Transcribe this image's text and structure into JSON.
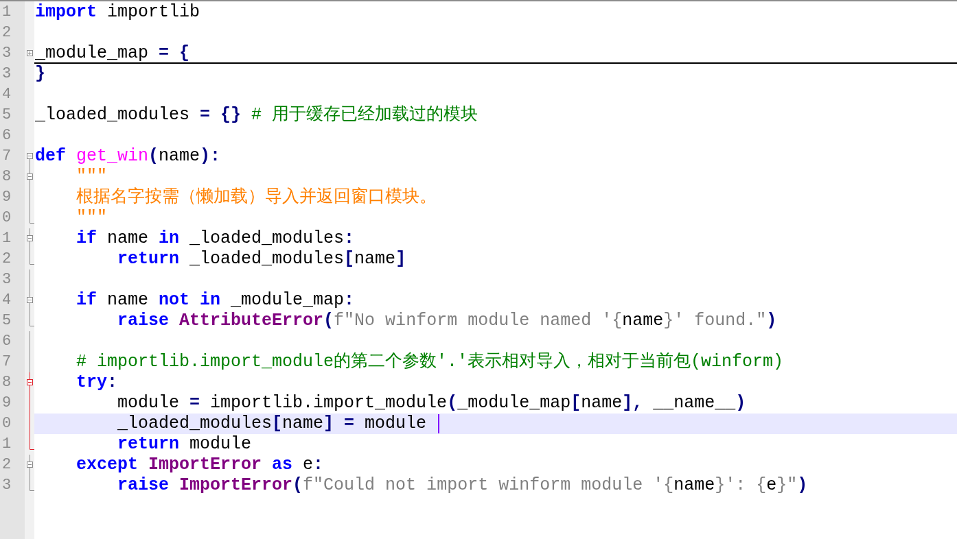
{
  "lines": [
    {
      "number": "1",
      "current": false,
      "tokens": [
        {
          "kind": "kw",
          "t": "import"
        },
        {
          "kind": "plain",
          "t": " importlib"
        }
      ]
    },
    {
      "number": "2",
      "current": false
    },
    {
      "number": "3",
      "fold": {
        "kind": "collapsed",
        "active": false
      },
      "current": false,
      "tokens": [
        {
          "kind": "plain",
          "t": "_module_map "
        },
        {
          "kind": "op",
          "t": "= {"
        }
      ]
    },
    {
      "number": "3",
      "current": false,
      "tokens": [
        {
          "kind": "op",
          "t": "}"
        }
      ]
    },
    {
      "number": "4",
      "current": false
    },
    {
      "number": "5",
      "current": false,
      "tokens": [
        {
          "kind": "plain",
          "t": "_loaded_modules "
        },
        {
          "kind": "op",
          "t": "= {}"
        },
        {
          "kind": "comment",
          "t": " # 用于缓存已经加载过的模块"
        }
      ]
    },
    {
      "number": "6",
      "current": false
    },
    {
      "number": "7",
      "fold": {
        "kind": "open-top",
        "active": false
      },
      "current": false,
      "tokens": [
        {
          "kind": "kw",
          "t": "def"
        },
        {
          "kind": "func",
          "t": " get_win"
        },
        {
          "kind": "op",
          "t": "("
        },
        {
          "kind": "plain",
          "t": "name"
        },
        {
          "kind": "op",
          "t": "):"
        }
      ]
    },
    {
      "number": "8",
      "fold": {
        "kind": "open",
        "active": false
      },
      "current": false,
      "tokens": [
        {
          "kind": "doc",
          "t": "    \"\"\""
        }
      ]
    },
    {
      "number": "9",
      "fold": {
        "kind": "body",
        "active": false
      },
      "current": false,
      "tokens": [
        {
          "kind": "doc",
          "t": "    根据名字按需（懒加载）导入并返回窗口模块。"
        }
      ]
    },
    {
      "number": "0",
      "fold": {
        "kind": "end",
        "active": false
      },
      "current": false,
      "tokens": [
        {
          "kind": "doc",
          "t": "    \"\"\""
        }
      ]
    },
    {
      "number": "1",
      "fold": {
        "kind": "open",
        "active": false
      },
      "current": false,
      "tokens": [
        {
          "kind": "kw",
          "t": "    if"
        },
        {
          "kind": "plain",
          "t": " name "
        },
        {
          "kind": "kw",
          "t": "in"
        },
        {
          "kind": "plain",
          "t": " _loaded_modules"
        },
        {
          "kind": "op",
          "t": ":"
        }
      ]
    },
    {
      "number": "2",
      "fold": {
        "kind": "end",
        "active": false
      },
      "current": false,
      "tokens": [
        {
          "kind": "kw",
          "t": "        return"
        },
        {
          "kind": "plain",
          "t": " _loaded_modules"
        },
        {
          "kind": "op",
          "t": "["
        },
        {
          "kind": "plain",
          "t": "name"
        },
        {
          "kind": "op",
          "t": "]"
        }
      ]
    },
    {
      "number": "3",
      "fold": {
        "kind": "body",
        "active": false
      },
      "current": false
    },
    {
      "number": "4",
      "fold": {
        "kind": "open",
        "active": false
      },
      "current": false,
      "tokens": [
        {
          "kind": "kw",
          "t": "    if"
        },
        {
          "kind": "plain",
          "t": " name "
        },
        {
          "kind": "kw",
          "t": "not in"
        },
        {
          "kind": "plain",
          "t": " _module_map"
        },
        {
          "kind": "op",
          "t": ":"
        }
      ]
    },
    {
      "number": "5",
      "fold": {
        "kind": "end",
        "active": false
      },
      "current": false,
      "tokens": [
        {
          "kind": "kw",
          "t": "        raise"
        },
        {
          "kind": "cls",
          "t": " AttributeError"
        },
        {
          "kind": "op",
          "t": "("
        },
        {
          "kind": "fstr",
          "t": "f\"No winform module named '{"
        },
        {
          "kind": "plain",
          "t": "name"
        },
        {
          "kind": "fstr",
          "t": "}' found.\""
        },
        {
          "kind": "op",
          "t": ")"
        }
      ]
    },
    {
      "number": "6",
      "fold": {
        "kind": "body",
        "active": false
      },
      "current": false
    },
    {
      "number": "7",
      "fold": {
        "kind": "body",
        "active": false
      },
      "current": false,
      "tokens": [
        {
          "kind": "comment",
          "t": "    # importlib.import_module的第二个参数'.'表示相对导入，相对于当前包(winform)"
        }
      ]
    },
    {
      "number": "8",
      "fold": {
        "kind": "open",
        "active": true
      },
      "current": false,
      "tokens": [
        {
          "kind": "kw",
          "t": "    try"
        },
        {
          "kind": "op",
          "t": ":"
        }
      ]
    },
    {
      "number": "9",
      "fold": {
        "kind": "body",
        "active": true
      },
      "current": false,
      "tokens": [
        {
          "kind": "plain",
          "t": "        module "
        },
        {
          "kind": "op",
          "t": "="
        },
        {
          "kind": "plain",
          "t": " importlib.import_module"
        },
        {
          "kind": "op",
          "t": "("
        },
        {
          "kind": "plain",
          "t": "_module_map"
        },
        {
          "kind": "op",
          "t": "["
        },
        {
          "kind": "plain",
          "t": "name"
        },
        {
          "kind": "op",
          "t": "],"
        },
        {
          "kind": "plain",
          "t": " __name__"
        },
        {
          "kind": "op",
          "t": ")"
        }
      ]
    },
    {
      "number": "0",
      "fold": {
        "kind": "body",
        "active": true
      },
      "current": true,
      "tokens": [
        {
          "kind": "plain",
          "t": "        _loaded_modules"
        },
        {
          "kind": "op",
          "t": "["
        },
        {
          "kind": "plain",
          "t": "name"
        },
        {
          "kind": "op",
          "t": "] ="
        },
        {
          "kind": "plain",
          "t": " module "
        }
      ]
    },
    {
      "number": "1",
      "fold": {
        "kind": "end",
        "active": true
      },
      "current": false,
      "tokens": [
        {
          "kind": "kw",
          "t": "        return"
        },
        {
          "kind": "plain",
          "t": " module"
        }
      ]
    },
    {
      "number": "2",
      "fold": {
        "kind": "open",
        "active": false
      },
      "current": false,
      "tokens": [
        {
          "kind": "kw",
          "t": "    except"
        },
        {
          "kind": "cls",
          "t": " ImportError"
        },
        {
          "kind": "kw",
          "t": " as"
        },
        {
          "kind": "plain",
          "t": " e"
        },
        {
          "kind": "op",
          "t": ":"
        }
      ]
    },
    {
      "number": "3",
      "fold": {
        "kind": "end",
        "active": false
      },
      "current": false,
      "tokens": [
        {
          "kind": "kw",
          "t": "        raise"
        },
        {
          "kind": "cls",
          "t": " ImportError"
        },
        {
          "kind": "op",
          "t": "("
        },
        {
          "kind": "fstr",
          "t": "f\"Could not import winform module '{"
        },
        {
          "kind": "plain",
          "t": "name"
        },
        {
          "kind": "fstr",
          "t": "}': {"
        },
        {
          "kind": "plain",
          "t": "e"
        },
        {
          "kind": "fstr",
          "t": "}\""
        },
        {
          "kind": "op",
          "t": ")"
        }
      ]
    }
  ]
}
